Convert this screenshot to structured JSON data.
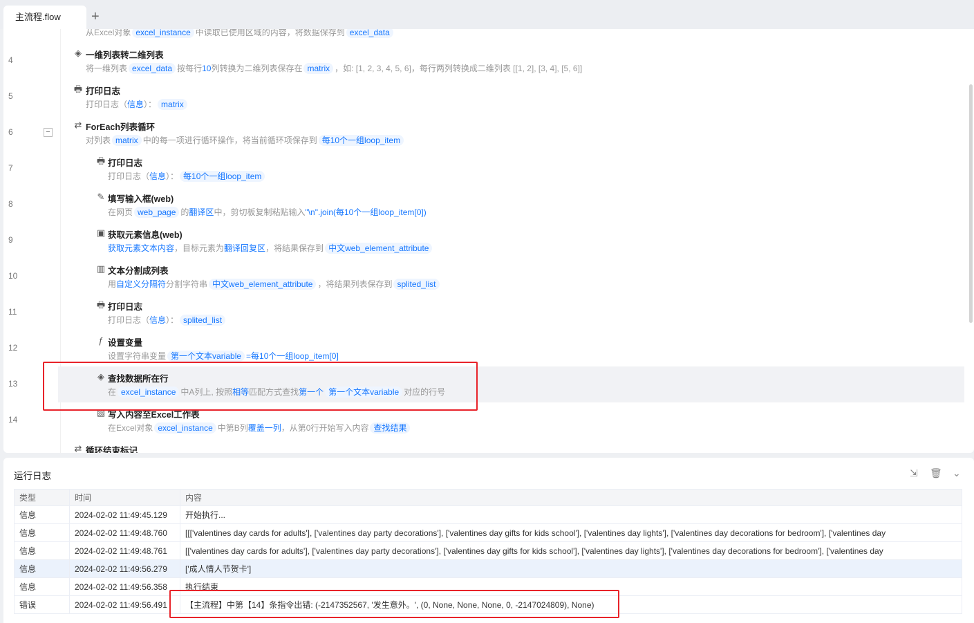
{
  "tabs": {
    "active": "主流程.flow",
    "add": "+"
  },
  "steps": [
    {
      "no": "",
      "level": 0,
      "icon": "excel-read-icon",
      "glyph": "▤",
      "title": "",
      "desc": [
        {
          "k": "text",
          "t": "从Excel对象"
        },
        {
          "k": "chip",
          "t": "excel_instance"
        },
        {
          "k": "text",
          "t": "中读取已使用区域的内容，将数据保存到"
        },
        {
          "k": "chip",
          "t": "excel_data"
        }
      ]
    },
    {
      "no": "4",
      "level": 0,
      "icon": "layers-icon",
      "glyph": "◈",
      "title": "一维列表转二维列表",
      "desc": [
        {
          "k": "text",
          "t": "将一维列表"
        },
        {
          "k": "chip",
          "t": "excel_data"
        },
        {
          "k": "text",
          "t": "按每行"
        },
        {
          "k": "lnk",
          "t": "10"
        },
        {
          "k": "text",
          "t": "列转换为二维列表保存在"
        },
        {
          "k": "chip",
          "t": "matrix"
        },
        {
          "k": "text",
          "t": "，如: [1, 2, 3, 4, 5, 6]，每行两列转换成二维列表 [[1, 2], [3, 4], [5, 6]]"
        }
      ]
    },
    {
      "no": "5",
      "level": 0,
      "icon": "printer-icon",
      "glyph": "🖶",
      "title": "打印日志",
      "desc": [
        {
          "k": "text",
          "t": "打印日志（"
        },
        {
          "k": "lnk",
          "t": "信息"
        },
        {
          "k": "text",
          "t": "）："
        },
        {
          "k": "chip",
          "t": "matrix"
        }
      ]
    },
    {
      "no": "6",
      "level": 0,
      "collapse": "−",
      "icon": "loop-icon",
      "glyph": "⇄",
      "title": "ForEach列表循环",
      "desc": [
        {
          "k": "text",
          "t": "对列表"
        },
        {
          "k": "chip",
          "t": "matrix"
        },
        {
          "k": "text",
          "t": "中的每一项进行循环操作，将当前循环项保存到"
        },
        {
          "k": "chip",
          "t": "每10个一组loop_item"
        }
      ]
    },
    {
      "no": "7",
      "level": 1,
      "icon": "printer-icon",
      "glyph": "🖶",
      "title": "打印日志",
      "desc": [
        {
          "k": "text",
          "t": "打印日志（"
        },
        {
          "k": "lnk",
          "t": "信息"
        },
        {
          "k": "text",
          "t": "）："
        },
        {
          "k": "chip",
          "t": "每10个一组loop_item"
        }
      ]
    },
    {
      "no": "8",
      "level": 1,
      "icon": "edit-input-icon",
      "glyph": "✎",
      "title": "填写输入框(web)",
      "desc": [
        {
          "k": "text",
          "t": "在网页"
        },
        {
          "k": "chip",
          "t": "web_page"
        },
        {
          "k": "text",
          "t": "的"
        },
        {
          "k": "lnk",
          "t": "翻译区"
        },
        {
          "k": "text",
          "t": "中，剪切板复制粘贴输入"
        },
        {
          "k": "lnk",
          "t": "\"\\n\".join(每10个一组loop_item[0])"
        }
      ]
    },
    {
      "no": "9",
      "level": 1,
      "icon": "web-element-icon",
      "glyph": "▣",
      "title": "获取元素信息(web)",
      "desc": [
        {
          "k": "lnk",
          "t": "获取元素文本内容"
        },
        {
          "k": "text",
          "t": "，目标元素为"
        },
        {
          "k": "lnk",
          "t": "翻译回复区"
        },
        {
          "k": "text",
          "t": "，将结果保存到"
        },
        {
          "k": "chip",
          "t": "中文web_element_attribute"
        }
      ]
    },
    {
      "no": "10",
      "level": 1,
      "icon": "text-split-icon",
      "glyph": "▥",
      "title": "文本分割成列表",
      "desc": [
        {
          "k": "text",
          "t": "用"
        },
        {
          "k": "lnk",
          "t": "自定义分隔符"
        },
        {
          "k": "text",
          "t": "分割字符串"
        },
        {
          "k": "chip",
          "t": "中文web_element_attribute"
        },
        {
          "k": "text",
          "t": "，将结果列表保存到"
        },
        {
          "k": "chip",
          "t": "splited_list"
        }
      ]
    },
    {
      "no": "11",
      "level": 1,
      "icon": "printer-icon",
      "glyph": "🖶",
      "title": "打印日志",
      "desc": [
        {
          "k": "text",
          "t": "打印日志（"
        },
        {
          "k": "lnk",
          "t": "信息"
        },
        {
          "k": "text",
          "t": "）："
        },
        {
          "k": "chip",
          "t": "splited_list"
        }
      ]
    },
    {
      "no": "12",
      "level": 1,
      "icon": "variable-icon",
      "glyph": "ƒ",
      "title": "设置变量",
      "desc": [
        {
          "k": "text",
          "t": "设置字符串变量"
        },
        {
          "k": "chip",
          "t": "第一个文本variable"
        },
        {
          "k": "lnk",
          "t": "=每10个一组loop_item[0]"
        }
      ]
    },
    {
      "no": "13",
      "level": 1,
      "hl": true,
      "icon": "layers-icon",
      "glyph": "◈",
      "title": "查找数据所在行",
      "desc": [
        {
          "k": "text",
          "t": "在"
        },
        {
          "k": "chip",
          "t": "excel_instance"
        },
        {
          "k": "text",
          "t": "中A列上, 按照"
        },
        {
          "k": "lnk",
          "t": "相等"
        },
        {
          "k": "text",
          "t": "匹配方式查找"
        },
        {
          "k": "lnk",
          "t": "第一个"
        },
        {
          "k": "chip",
          "t": "第一个文本variable"
        },
        {
          "k": "text",
          "t": "对应的行号"
        }
      ]
    },
    {
      "no": "14",
      "level": 1,
      "icon": "excel-write-icon",
      "glyph": "▧",
      "title": "写入内容至Excel工作表",
      "desc": [
        {
          "k": "text",
          "t": "在Excel对象"
        },
        {
          "k": "chip",
          "t": "excel_instance"
        },
        {
          "k": "text",
          "t": "中第B列"
        },
        {
          "k": "lnk",
          "t": "覆盖一列"
        },
        {
          "k": "text",
          "t": "，从第0行开始写入内容"
        },
        {
          "k": "chip",
          "t": "查找结果"
        }
      ]
    },
    {
      "no": "",
      "level": 0,
      "icon": "loop-end-icon",
      "glyph": "⇄",
      "title": "循环结束标记",
      "desc": []
    }
  ],
  "log": {
    "title": "运行日志",
    "columns": [
      "类型",
      "时间",
      "内容"
    ],
    "rows": [
      [
        "信息",
        "2024-02-02 11:49:45.129",
        "开始执行..."
      ],
      [
        "信息",
        "2024-02-02 11:49:48.760",
        "[[['valentines day cards for adults'], ['valentines day party decorations'], ['valentines day gifts for kids school'], ['valentines day lights'], ['valentines day decorations for bedroom'], ['valentines day"
      ],
      [
        "信息",
        "2024-02-02 11:49:48.761",
        "[['valentines day cards for adults'], ['valentines day party decorations'], ['valentines day gifts for kids school'], ['valentines day lights'], ['valentines day decorations for bedroom'], ['valentines day"
      ],
      [
        "信息",
        "2024-02-02 11:49:56.279",
        "['成人情人节贺卡']"
      ],
      [
        "信息",
        "2024-02-02 11:49:56.358",
        "执行结束"
      ],
      [
        "错误",
        "2024-02-02 11:49:56.491",
        "【主流程】中第【14】条指令出错: (-2147352567, '发生意外。', (0, None, None, None, 0, -2147024809), None)"
      ]
    ]
  }
}
